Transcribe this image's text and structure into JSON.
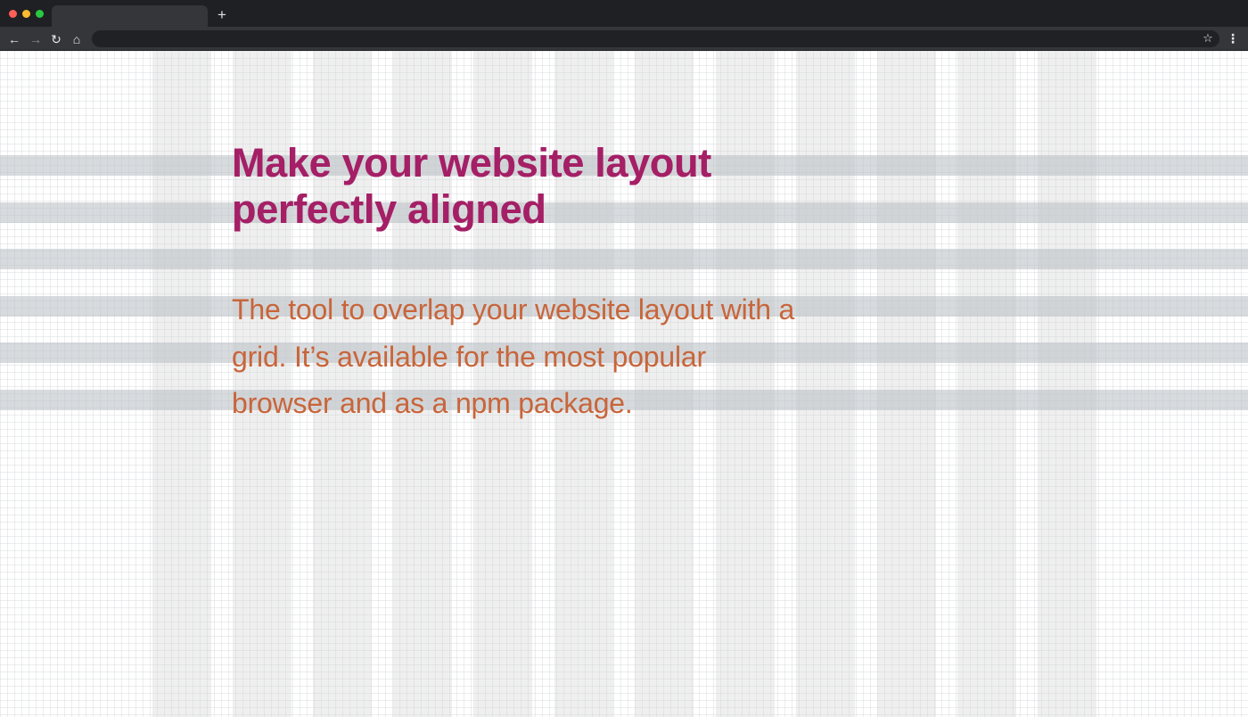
{
  "browser": {
    "new_tab_label": "+",
    "nav": {
      "back_icon": "←",
      "forward_icon": "→",
      "reload_icon": "↻",
      "home_icon": "⌂"
    },
    "bookmark_icon": "☆",
    "menu_icon": "⋮"
  },
  "hero": {
    "headline_line_1": "Make your website layout",
    "headline_line_2": "perfectly aligned",
    "description_line_1": "The tool to overlap your website layout with a",
    "description_line_2": "grid. It’s available for the most popular",
    "description_line_3": "browser and as a npm package."
  },
  "colors": {
    "chrome_dark": "#1f2023",
    "toolbar": "#35363a",
    "headline": "#a51f66",
    "description": "#c8653a",
    "column_overlay": "#d6d6d6",
    "row_overlay": "#bcc1c7"
  }
}
